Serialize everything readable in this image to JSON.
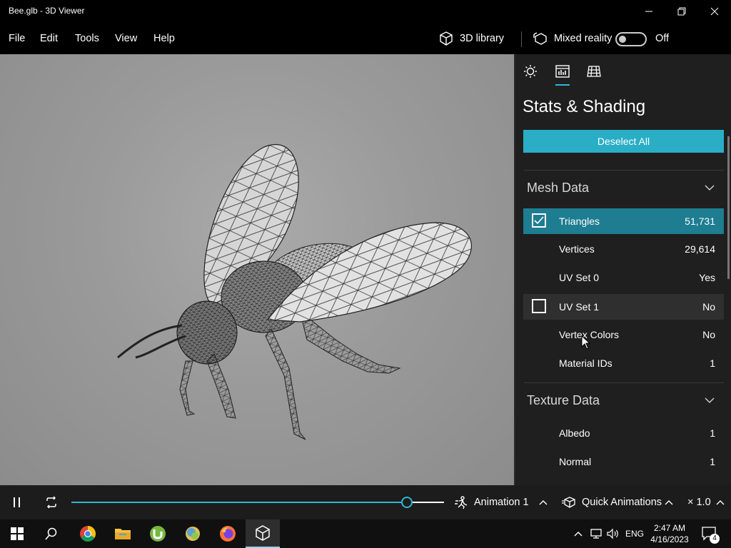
{
  "window": {
    "title": "Bee.glb - 3D Viewer"
  },
  "menu": {
    "items": [
      "File",
      "Edit",
      "Tools",
      "View",
      "Help"
    ],
    "library_label": "3D library",
    "mixed_reality_label": "Mixed reality",
    "mixed_reality_state": "Off"
  },
  "panel": {
    "title": "Stats & Shading",
    "deselect_label": "Deselect All",
    "tabs": [
      "lighting-icon",
      "stats-icon",
      "grid-icon"
    ],
    "mesh_section": "Mesh Data",
    "mesh_rows": [
      {
        "label": "Triangles",
        "value": "51,731",
        "checked": true
      },
      {
        "label": "Vertices",
        "value": "29,614"
      },
      {
        "label": "UV Set 0",
        "value": "Yes"
      },
      {
        "label": "UV Set 1",
        "value": "No",
        "checked": false
      },
      {
        "label": "Vertex Colors",
        "value": "No"
      },
      {
        "label": "Material IDs",
        "value": "1"
      }
    ],
    "texture_section": "Texture Data",
    "texture_rows": [
      {
        "label": "Albedo",
        "value": "1"
      },
      {
        "label": "Normal",
        "value": "1"
      }
    ]
  },
  "animation": {
    "progress": 0.9,
    "animation_name": "Animation 1",
    "quick_label": "Quick Animations",
    "speed": "× 1.0"
  },
  "taskbar": {
    "language": "ENG",
    "time": "2:47 AM",
    "date": "4/16/2023",
    "notification_count": "4"
  },
  "colors": {
    "accent": "#2aaec6",
    "selected_row": "#1e7d90"
  }
}
